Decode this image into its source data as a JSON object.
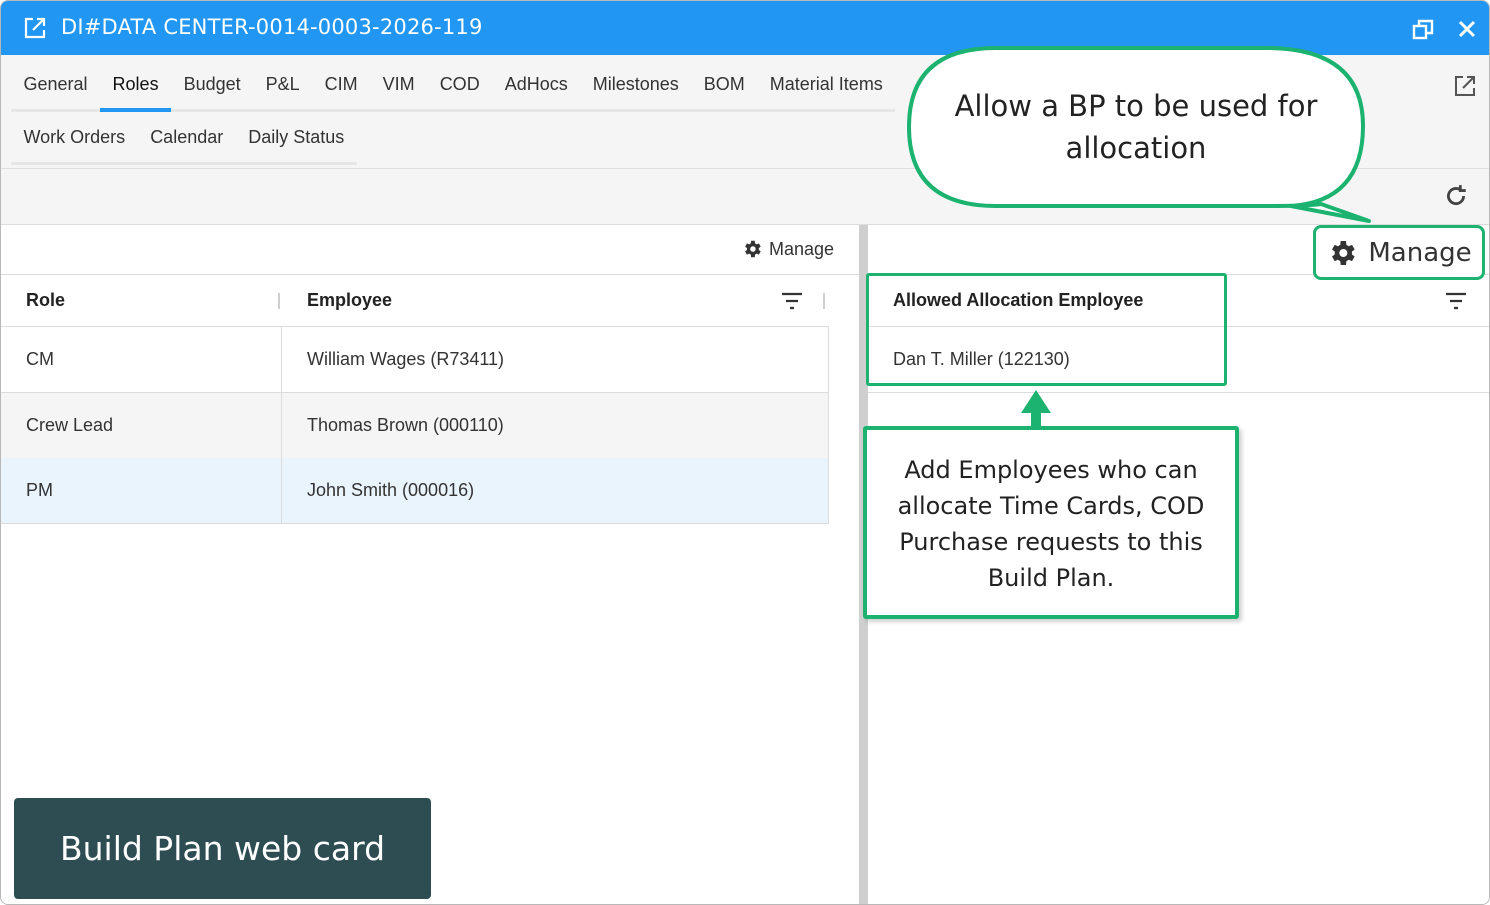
{
  "window": {
    "title": "DI#DATA CENTER-0014-0003-2026-119"
  },
  "tabs": {
    "row1": [
      "General",
      "Roles",
      "Budget",
      "P&L",
      "CIM",
      "VIM",
      "COD",
      "AdHocs",
      "Milestones",
      "BOM",
      "Material Items"
    ],
    "row2": [
      "Work Orders",
      "Calendar",
      "Daily Status"
    ],
    "active": "Roles"
  },
  "roles_grid": {
    "manage_label": "Manage",
    "columns": [
      "Role",
      "Employee"
    ],
    "rows": [
      {
        "role": "CM",
        "employee": "William Wages (R73411)"
      },
      {
        "role": "Crew Lead",
        "employee": "Thomas Brown (000110)"
      },
      {
        "role": "PM",
        "employee": "John Smith (000016)"
      }
    ]
  },
  "allocation_grid": {
    "manage_label": "Manage",
    "column": "Allowed Allocation Employee",
    "rows": [
      "Dan T. Miller (122130)"
    ]
  },
  "annotations": {
    "bubble": "Allow a BP to be used for allocation",
    "callout": "Add Employees who can allocate Time Cards, COD Purchase requests to this Build Plan.",
    "label": "Build Plan web card",
    "accent_color": "#1bb36f",
    "label_color": "#2e4d52"
  },
  "theme": {
    "titlebar_color": "#2196f3",
    "selected_row_color": "#e9f4fd"
  },
  "icons": [
    "external-link-icon",
    "restore-window-icon",
    "close-icon",
    "popout-icon",
    "refresh-icon",
    "gear-icon",
    "filter-icon"
  ]
}
